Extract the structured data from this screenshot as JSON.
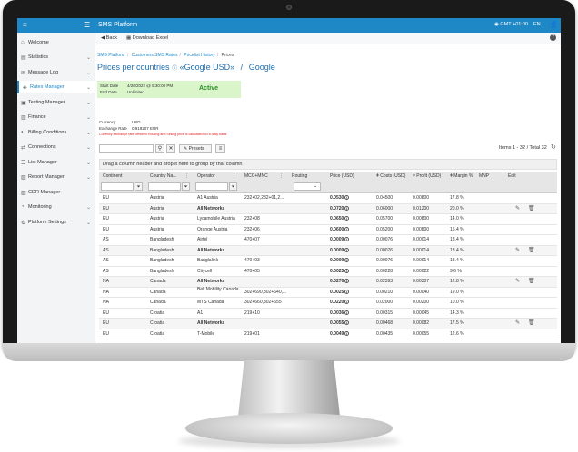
{
  "app": {
    "title": "SMS Platform",
    "timezone": "GMT +01:00",
    "language": "EN"
  },
  "sidebar": {
    "items": [
      {
        "label": "Welcome",
        "icon": "home-icon",
        "chevron": false,
        "active": false
      },
      {
        "label": "Statistics",
        "icon": "chart-icon",
        "chevron": true,
        "active": false
      },
      {
        "label": "Message Log",
        "icon": "message-icon",
        "chevron": true,
        "active": false
      },
      {
        "label": "Rates Manager",
        "icon": "tag-icon",
        "chevron": true,
        "active": true
      },
      {
        "label": "Testing Manager",
        "icon": "test-icon",
        "chevron": true,
        "active": false
      },
      {
        "label": "Finance",
        "icon": "finance-icon",
        "chevron": true,
        "active": false
      },
      {
        "label": "Billing Conditions",
        "icon": "billing-icon",
        "chevron": true,
        "active": false
      },
      {
        "label": "Connections",
        "icon": "connections-icon",
        "chevron": true,
        "active": false
      },
      {
        "label": "List Manager",
        "icon": "list-icon",
        "chevron": true,
        "active": false
      },
      {
        "label": "Report Manager",
        "icon": "report-icon",
        "chevron": true,
        "active": false
      },
      {
        "label": "CDR Manager",
        "icon": "cdr-icon",
        "chevron": false,
        "active": false
      },
      {
        "label": "Monitoring",
        "icon": "monitoring-icon",
        "chevron": true,
        "active": false
      },
      {
        "label": "Platform Settings",
        "icon": "settings-icon",
        "chevron": true,
        "active": false
      }
    ]
  },
  "toolbar": {
    "back_label": "Back",
    "download_label": "Download Excel"
  },
  "breadcrumb": [
    "SMS Platform",
    "Customers SMS Rates",
    "Pricelist History",
    "Prices"
  ],
  "page": {
    "title": "Prices per countries",
    "pricelist": "«Google USD»",
    "slash": "/",
    "customer": "Google"
  },
  "info": {
    "start_label": "Start Date",
    "start_value": "4/26/2022 @ 5:30:00 PM",
    "end_label": "End Date",
    "end_value": "Unlimited",
    "status": "Active"
  },
  "currency": {
    "label": "Currency",
    "value": "USD",
    "rate_label": "Exchange Rate",
    "rate_value": "0.919207 EUR"
  },
  "warning": "Currency exchange rate between Routing and Selling price is calculated on a daily basis",
  "grid_tools": {
    "presets_label": "Presets",
    "items_count": "Items 1 - 32 / Total 32",
    "group_hint": "Drag a column header and drop it here to group by that column"
  },
  "columns": [
    "Continent",
    "Country Na...",
    "Operator",
    "MCC+MNC",
    "Routing",
    "Price (USD)",
    "Costs (USD)",
    "Profit (USD)",
    "Margin %",
    "MNP",
    "Edit"
  ],
  "rows": [
    [
      "EU",
      "Austria",
      "A1 Austria",
      "232+02,232+01,2...",
      "",
      "0.0530",
      "0.04500",
      "0.00800",
      "17.8 %",
      "",
      ""
    ],
    [
      "EU",
      "Austria",
      "All Networks",
      "",
      "",
      "0.0720",
      "0.06000",
      "0.01200",
      "20.0 %",
      "",
      "edit"
    ],
    [
      "EU",
      "Austria",
      "Lycamobile Austria",
      "232+08",
      "",
      "0.0650",
      "0.05700",
      "0.00800",
      "14.0 %",
      "",
      ""
    ],
    [
      "EU",
      "Austria",
      "Orange Austria",
      "232+06",
      "",
      "0.0600",
      "0.05200",
      "0.00800",
      "15.4 %",
      "",
      ""
    ],
    [
      "AS",
      "Bangladesh",
      "Airtel",
      "470+07",
      "",
      "0.0009",
      "0.00076",
      "0.00014",
      "18.4 %",
      "",
      ""
    ],
    [
      "AS",
      "Bangladesh",
      "All Networks",
      "",
      "",
      "0.0009",
      "0.00076",
      "0.00014",
      "18.4 %",
      "",
      "edit"
    ],
    [
      "AS",
      "Bangladesh",
      "Banglalink",
      "470+03",
      "",
      "0.0009",
      "0.00076",
      "0.00014",
      "18.4 %",
      "",
      ""
    ],
    [
      "AS",
      "Bangladesh",
      "Citycell",
      "470+05",
      "",
      "0.0025",
      "0.00228",
      "0.00022",
      "9.6 %",
      "",
      ""
    ],
    [
      "NA",
      "Canada",
      "All Networks",
      "",
      "",
      "0.0270",
      "0.02393",
      "0.00307",
      "12.8 %",
      "",
      "edit"
    ],
    [
      "NA",
      "Canada",
      "Bell Mobility Canada",
      "302+690,302+640,...",
      "",
      "0.0025",
      "0.00210",
      "0.00040",
      "19.0 %",
      "",
      ""
    ],
    [
      "NA",
      "Canada",
      "MTS Canada",
      "302+660,302+655",
      "",
      "0.0220",
      "0.02000",
      "0.00200",
      "10.0 %",
      "",
      ""
    ],
    [
      "EU",
      "Croatia",
      "A1",
      "219+10",
      "",
      "0.0036",
      "0.00315",
      "0.00045",
      "14.3 %",
      "",
      ""
    ],
    [
      "EU",
      "Croatia",
      "All Networks",
      "",
      "",
      "0.0055",
      "0.00468",
      "0.00082",
      "17.5 %",
      "",
      "edit"
    ],
    [
      "EU",
      "Croatia",
      "T-Mobile",
      "219+01",
      "",
      "0.0049",
      "0.00435",
      "0.00055",
      "12.6 %",
      "",
      ""
    ]
  ],
  "colors": {
    "primary": "#1e88c7",
    "active_bg": "#d9f5c9",
    "active_text": "#2e8b2e",
    "warning": "#e02020"
  }
}
